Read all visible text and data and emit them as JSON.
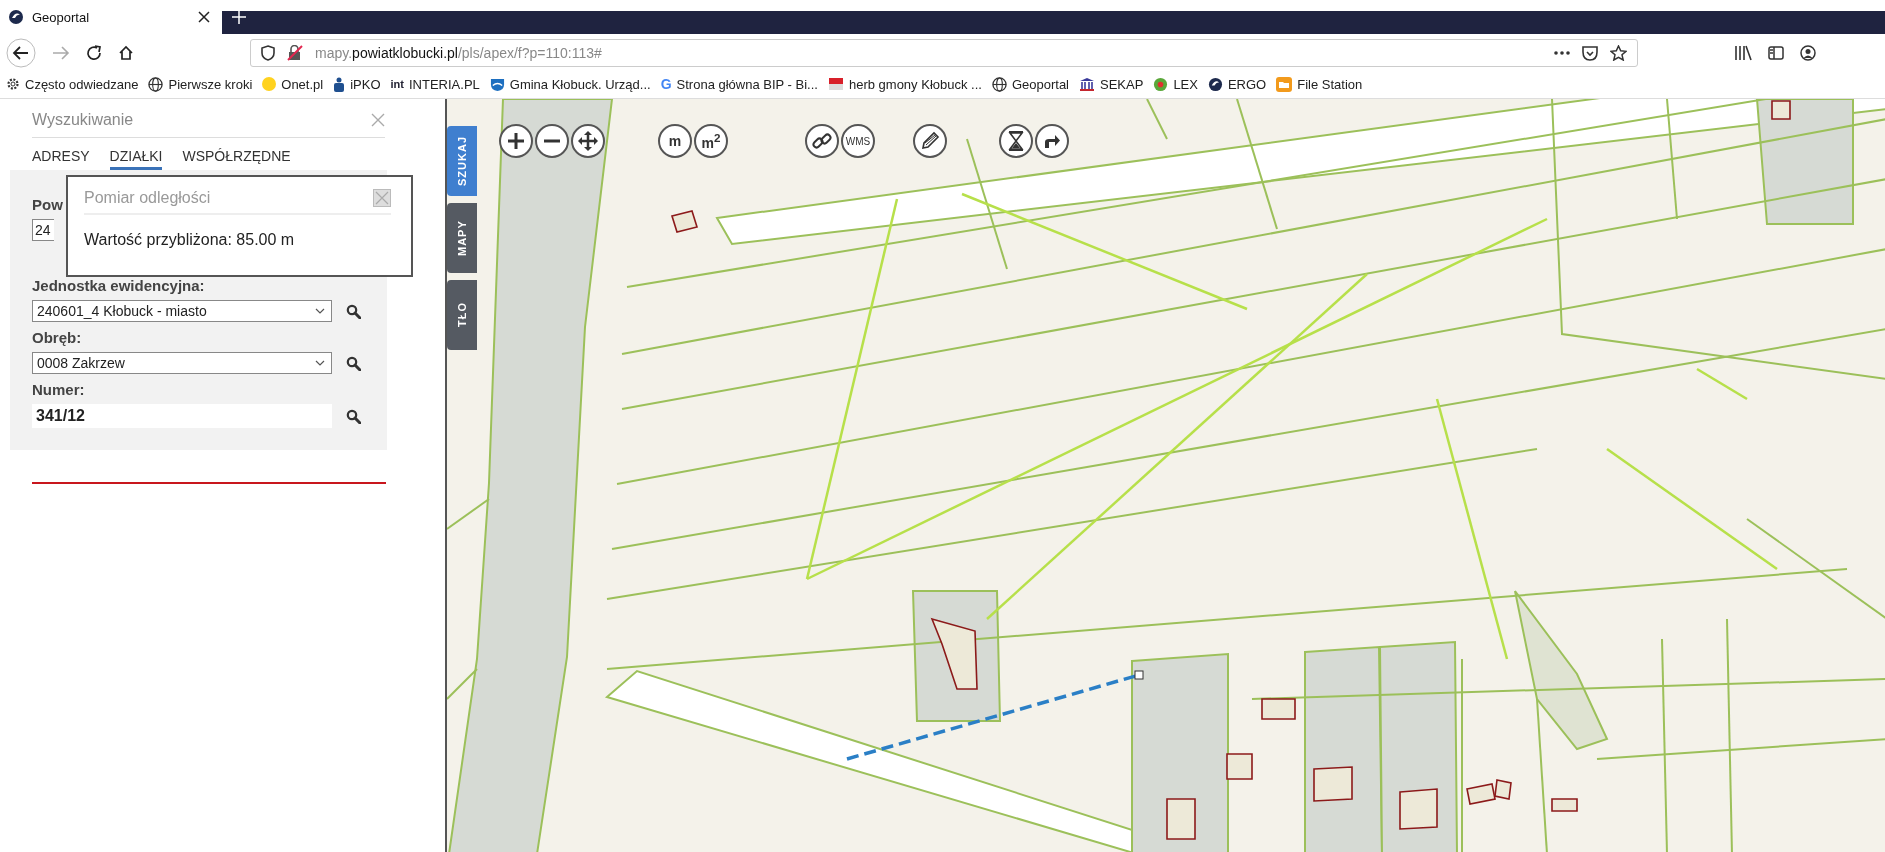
{
  "browser": {
    "tab": {
      "title": "Geoportal",
      "selected": true
    },
    "url": {
      "prefix": "mapy.",
      "domain": "powiatklobucki.pl",
      "path": "/pls/apex/f?p=110:113#"
    },
    "bookmarks": [
      {
        "kind": "gear",
        "label": "Często odwiedzane"
      },
      {
        "kind": "globe",
        "label": "Pierwsze kroki"
      },
      {
        "kind": "dot",
        "label": "Onet.pl"
      },
      {
        "kind": "bank",
        "label": "iPKO"
      },
      {
        "kind": "text",
        "mark": "int",
        "label": "INTERIA.PL"
      },
      {
        "kind": "shield",
        "label": "Gmina Kłobuck. Urząd..."
      },
      {
        "kind": "letter",
        "mark": "G",
        "label": "Strona główna BIP - Bi..."
      },
      {
        "kind": "flag",
        "label": "herb gmony Kłobuck ..."
      },
      {
        "kind": "globe",
        "label": "Geoportal"
      },
      {
        "kind": "columns",
        "label": "SEKAP"
      },
      {
        "kind": "ball",
        "label": "LEX"
      },
      {
        "kind": "swirl",
        "label": "ERGO"
      },
      {
        "kind": "folder",
        "label": "File Station"
      }
    ]
  },
  "search_panel": {
    "title": "Wyszukiwanie",
    "tabs": [
      {
        "label": "ADRESY",
        "selected": false
      },
      {
        "label": "DZIAŁKI",
        "selected": true
      },
      {
        "label": "WSPÓŁRZĘDNE",
        "selected": false
      }
    ],
    "fields": [
      {
        "kind": "clipped",
        "label": "Pow",
        "value": "24"
      },
      {
        "kind": "select",
        "label": "Jednostka ewidencyjna:",
        "value": "240601_4 Kłobuck - miasto"
      },
      {
        "kind": "select",
        "label": "Obręb:",
        "value": "0008 Zakrzew"
      },
      {
        "kind": "input",
        "label": "Numer:",
        "value": "341/12"
      }
    ]
  },
  "measure_popup": {
    "title": "Pomiar odległości",
    "text": "Wartość przybliżona: 85.00 m"
  },
  "side_tabs": [
    {
      "label": "SZUKAJ",
      "selected": true
    },
    {
      "label": "MAPY",
      "selected": false
    },
    {
      "label": "TŁO",
      "selected": false
    }
  ],
  "map_tools": [
    [
      {
        "kind": "zoom-in"
      },
      {
        "kind": "zoom-out"
      },
      {
        "kind": "pan"
      }
    ],
    [
      {
        "kind": "label",
        "label": "m"
      },
      {
        "kind": "label",
        "label": "m$^{2}$"
      }
    ],
    [
      {
        "kind": "link"
      },
      {
        "kind": "label",
        "label": "WMS"
      }
    ],
    [
      {
        "kind": "pencil"
      }
    ],
    [
      {
        "kind": "hourglass"
      },
      {
        "kind": "share"
      }
    ]
  ]
}
